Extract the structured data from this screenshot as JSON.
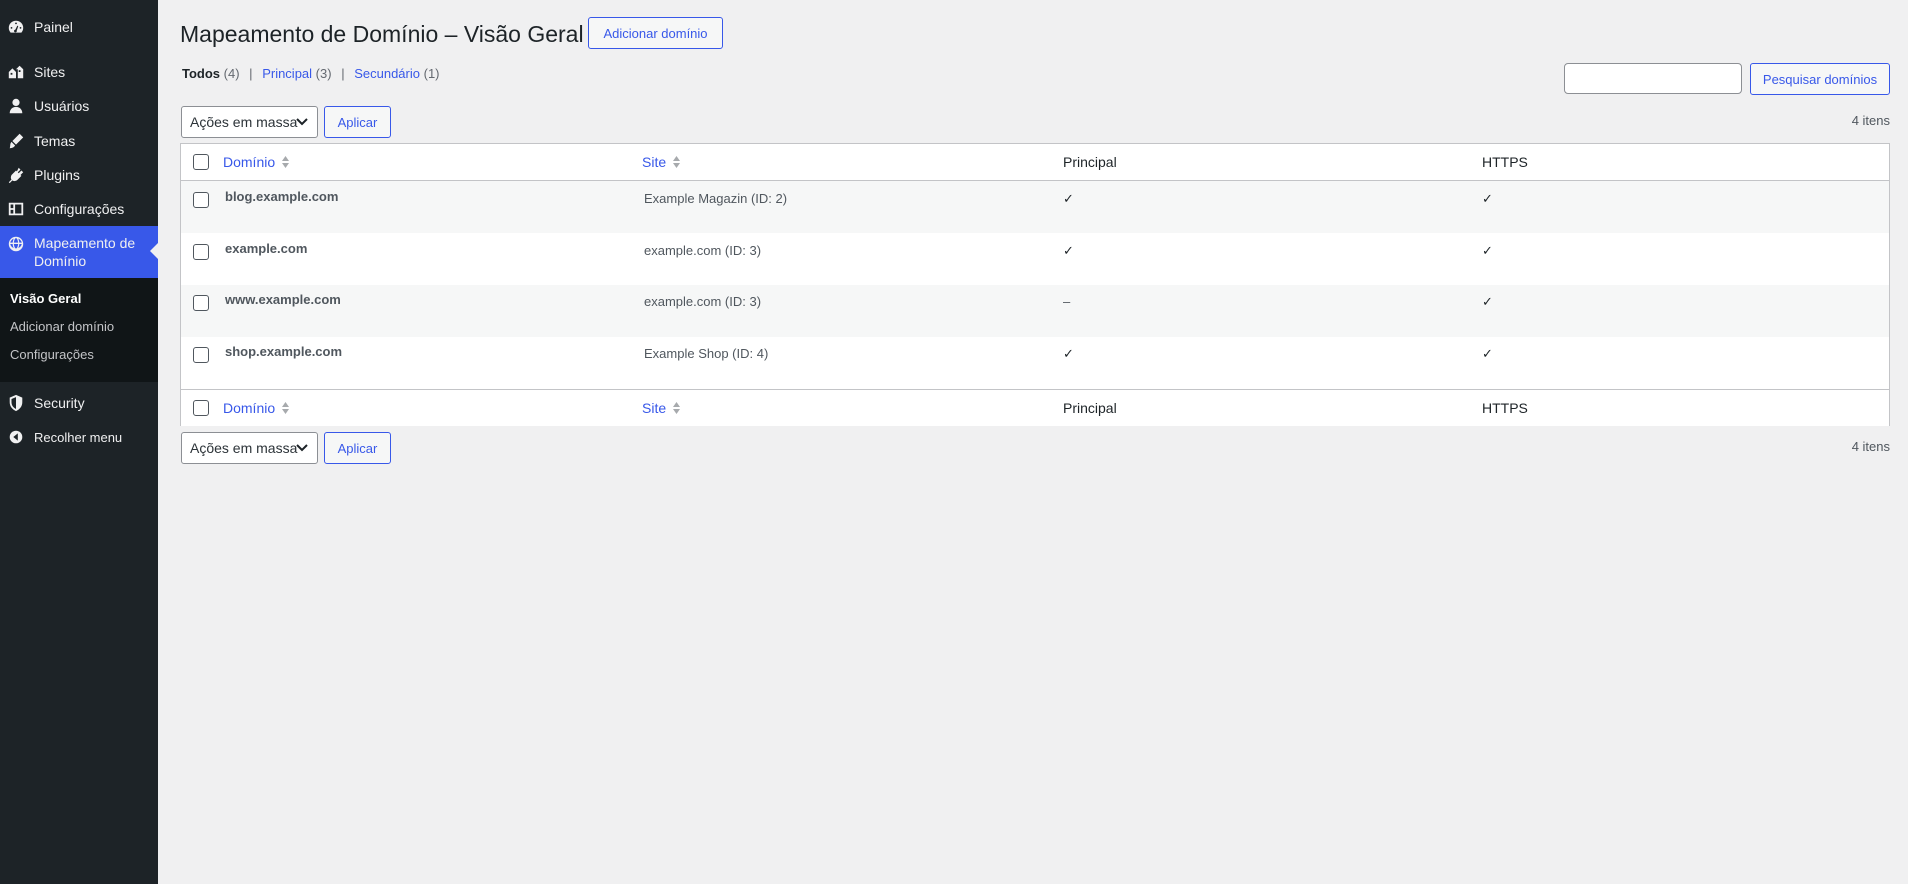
{
  "sidebar": {
    "items": [
      {
        "label": "Painel",
        "icon": "dashboard-icon"
      },
      {
        "label": "Sites",
        "icon": "sites-icon"
      },
      {
        "label": "Usuários",
        "icon": "users-icon"
      },
      {
        "label": "Temas",
        "icon": "themes-icon"
      },
      {
        "label": "Plugins",
        "icon": "plugins-icon"
      },
      {
        "label": "Configurações",
        "icon": "settings-icon"
      },
      {
        "label": "Mapeamento de Domínio",
        "icon": "globe-icon"
      },
      {
        "label": "Security",
        "icon": "shield-icon"
      },
      {
        "label": "Recolher menu",
        "icon": "collapse-icon"
      }
    ],
    "submenu": [
      "Visão Geral",
      "Adicionar domínio",
      "Configurações"
    ]
  },
  "header": {
    "title": "Mapeamento de Domínio – Visão Geral",
    "add_button": "Adicionar domínio"
  },
  "filters": {
    "all_label": "Todos",
    "all_count": "(4)",
    "primary_label": "Principal",
    "primary_count": "(3)",
    "secondary_label": "Secundário",
    "secondary_count": "(1)"
  },
  "search": {
    "button": "Pesquisar domínios",
    "value": ""
  },
  "bulk": {
    "select": "Ações em massa",
    "apply": "Aplicar"
  },
  "items_count": "4 itens",
  "table": {
    "columns": [
      "Domínio",
      "Site",
      "Principal",
      "HTTPS"
    ],
    "rows": [
      {
        "domain": "blog.example.com",
        "site": "Example Magazin (ID: 2)",
        "primary": "✓",
        "https": "✓"
      },
      {
        "domain": "example.com",
        "site": "example.com (ID: 3)",
        "primary": "✓",
        "https": "✓"
      },
      {
        "domain": "www.example.com",
        "site": "example.com (ID: 3)",
        "primary": "–",
        "https": "✓"
      },
      {
        "domain": "shop.example.com",
        "site": "Example Shop (ID: 4)",
        "primary": "✓",
        "https": "✓"
      }
    ]
  },
  "colors": {
    "accent": "#3858e9",
    "sidebar_bg": "#1d2327",
    "submenu_bg": "#101517",
    "page_bg": "#f0f0f1"
  }
}
